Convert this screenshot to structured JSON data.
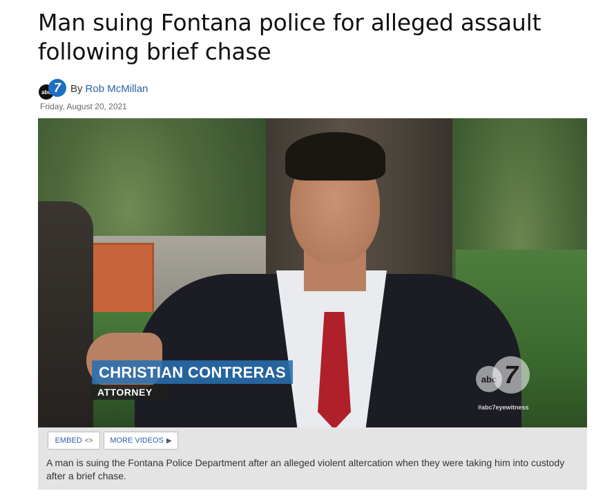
{
  "article": {
    "headline": "Man suing Fontana police for alleged assault following brief chase",
    "byline_prefix": "By",
    "author": "Rob McMillan",
    "date": "Friday, August 20, 2021"
  },
  "byline_logo": {
    "disc_text": "abc",
    "seven_text": "7",
    "icon": "abc7-logo-icon"
  },
  "video": {
    "lower_third_name": "CHRISTIAN CONTRERAS",
    "lower_third_title": "ATTORNEY",
    "watermark_disc": "abc",
    "watermark_seven": "7",
    "hashtag": "#abc7eyewitness",
    "accent_color": "#286eaf"
  },
  "video_footer": {
    "embed_label": "EMBED",
    "embed_icon": "<>",
    "more_videos_label": "MORE VIDEOS",
    "more_videos_icon": "▶",
    "caption": "A man is suing the Fontana Police Department after an alleged violent altercation when they were taking him into custody after a brief chase."
  }
}
